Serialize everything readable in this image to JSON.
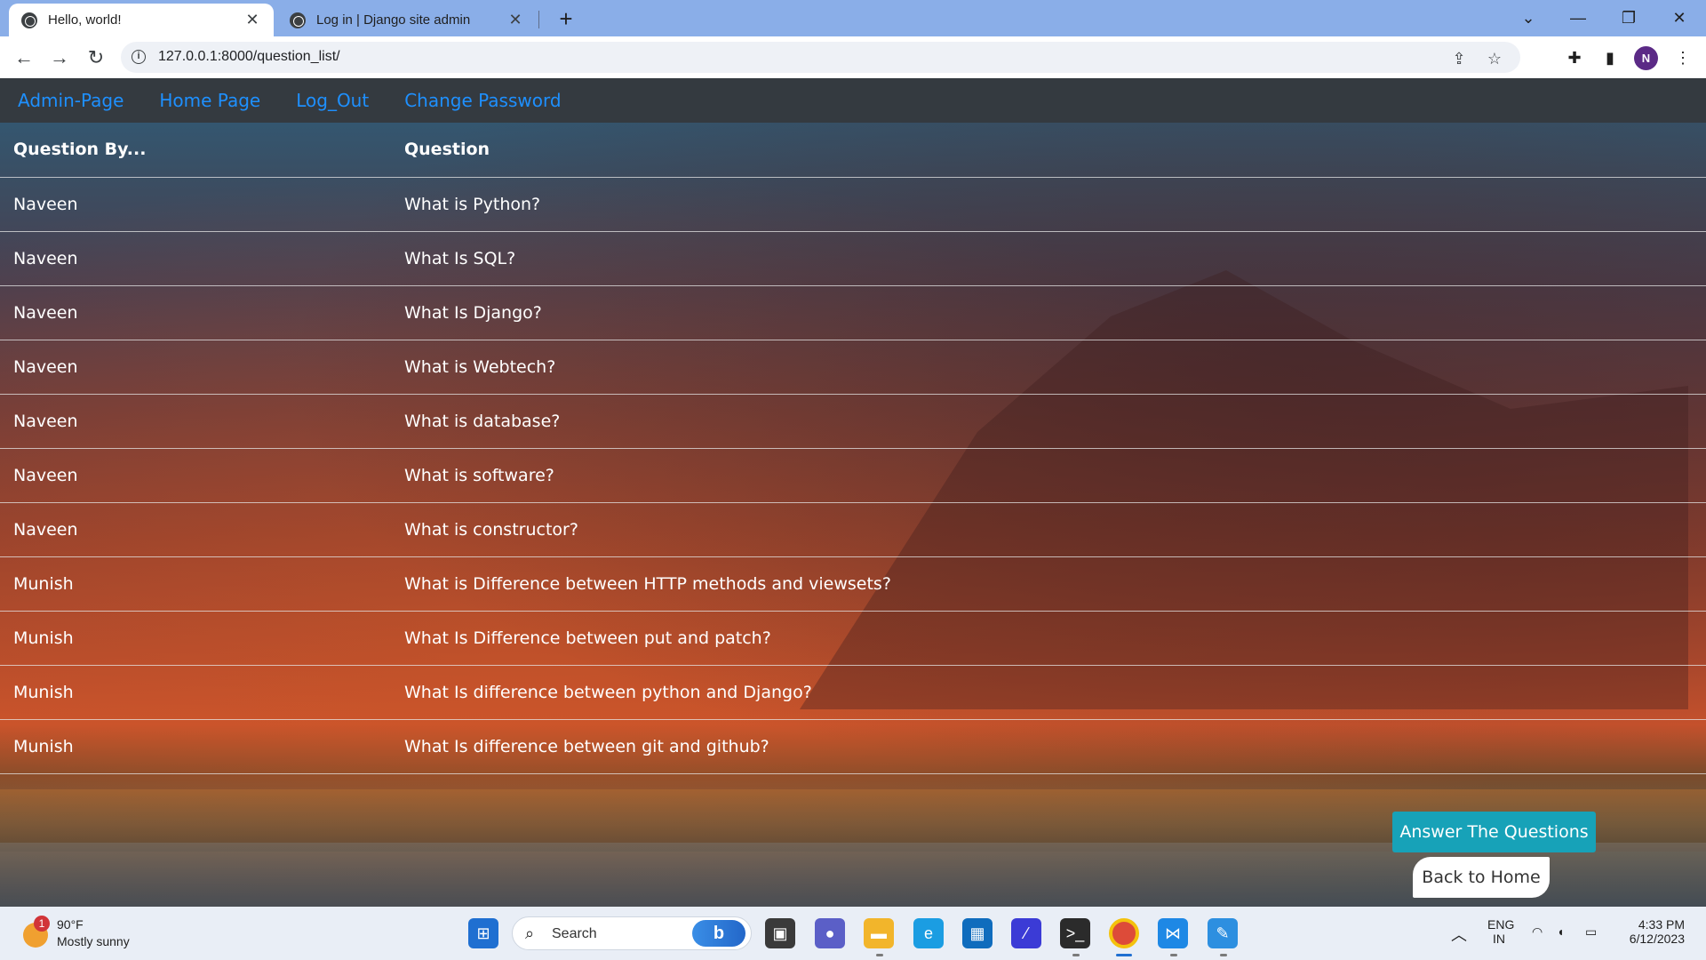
{
  "browser": {
    "tabs": [
      {
        "title": "Hello, world!",
        "active": true
      },
      {
        "title": "Log in | Django site admin",
        "active": false
      }
    ],
    "url": "127.0.0.1:8000/question_list/",
    "profile_initial": "N"
  },
  "navbar": {
    "links": [
      "Admin-Page",
      "Home Page",
      "Log_Out",
      "Change Password"
    ]
  },
  "table": {
    "headers": [
      "Question By...",
      "Question"
    ],
    "rows": [
      [
        "Naveen",
        "What is Python?"
      ],
      [
        "Naveen",
        "What Is SQL?"
      ],
      [
        "Naveen",
        "What Is Django?"
      ],
      [
        "Naveen",
        "What is Webtech?"
      ],
      [
        "Naveen",
        "What is database?"
      ],
      [
        "Naveen",
        "What is software?"
      ],
      [
        "Naveen",
        "What is constructor?"
      ],
      [
        "Munish",
        "What is Difference between HTTP methods and viewsets?"
      ],
      [
        "Munish",
        "What Is Difference between put and patch?"
      ],
      [
        "Munish",
        "What Is difference between python and Django?"
      ],
      [
        "Munish",
        "What Is difference between git and github?"
      ]
    ]
  },
  "buttons": {
    "answer": "Answer The Questions",
    "back_home": "Back to Home"
  },
  "taskbar": {
    "weather_temp": "90°F",
    "weather_cond": "Mostly sunny",
    "weather_badge": "1",
    "search_label": "Search",
    "lang_top": "ENG",
    "lang_bottom": "IN",
    "time": "4:33 PM",
    "date": "6/12/2023"
  },
  "colors": {
    "navbar_bg": "#343a40",
    "nav_link": "#1e90ff",
    "answer_button": "#17a2b8"
  }
}
